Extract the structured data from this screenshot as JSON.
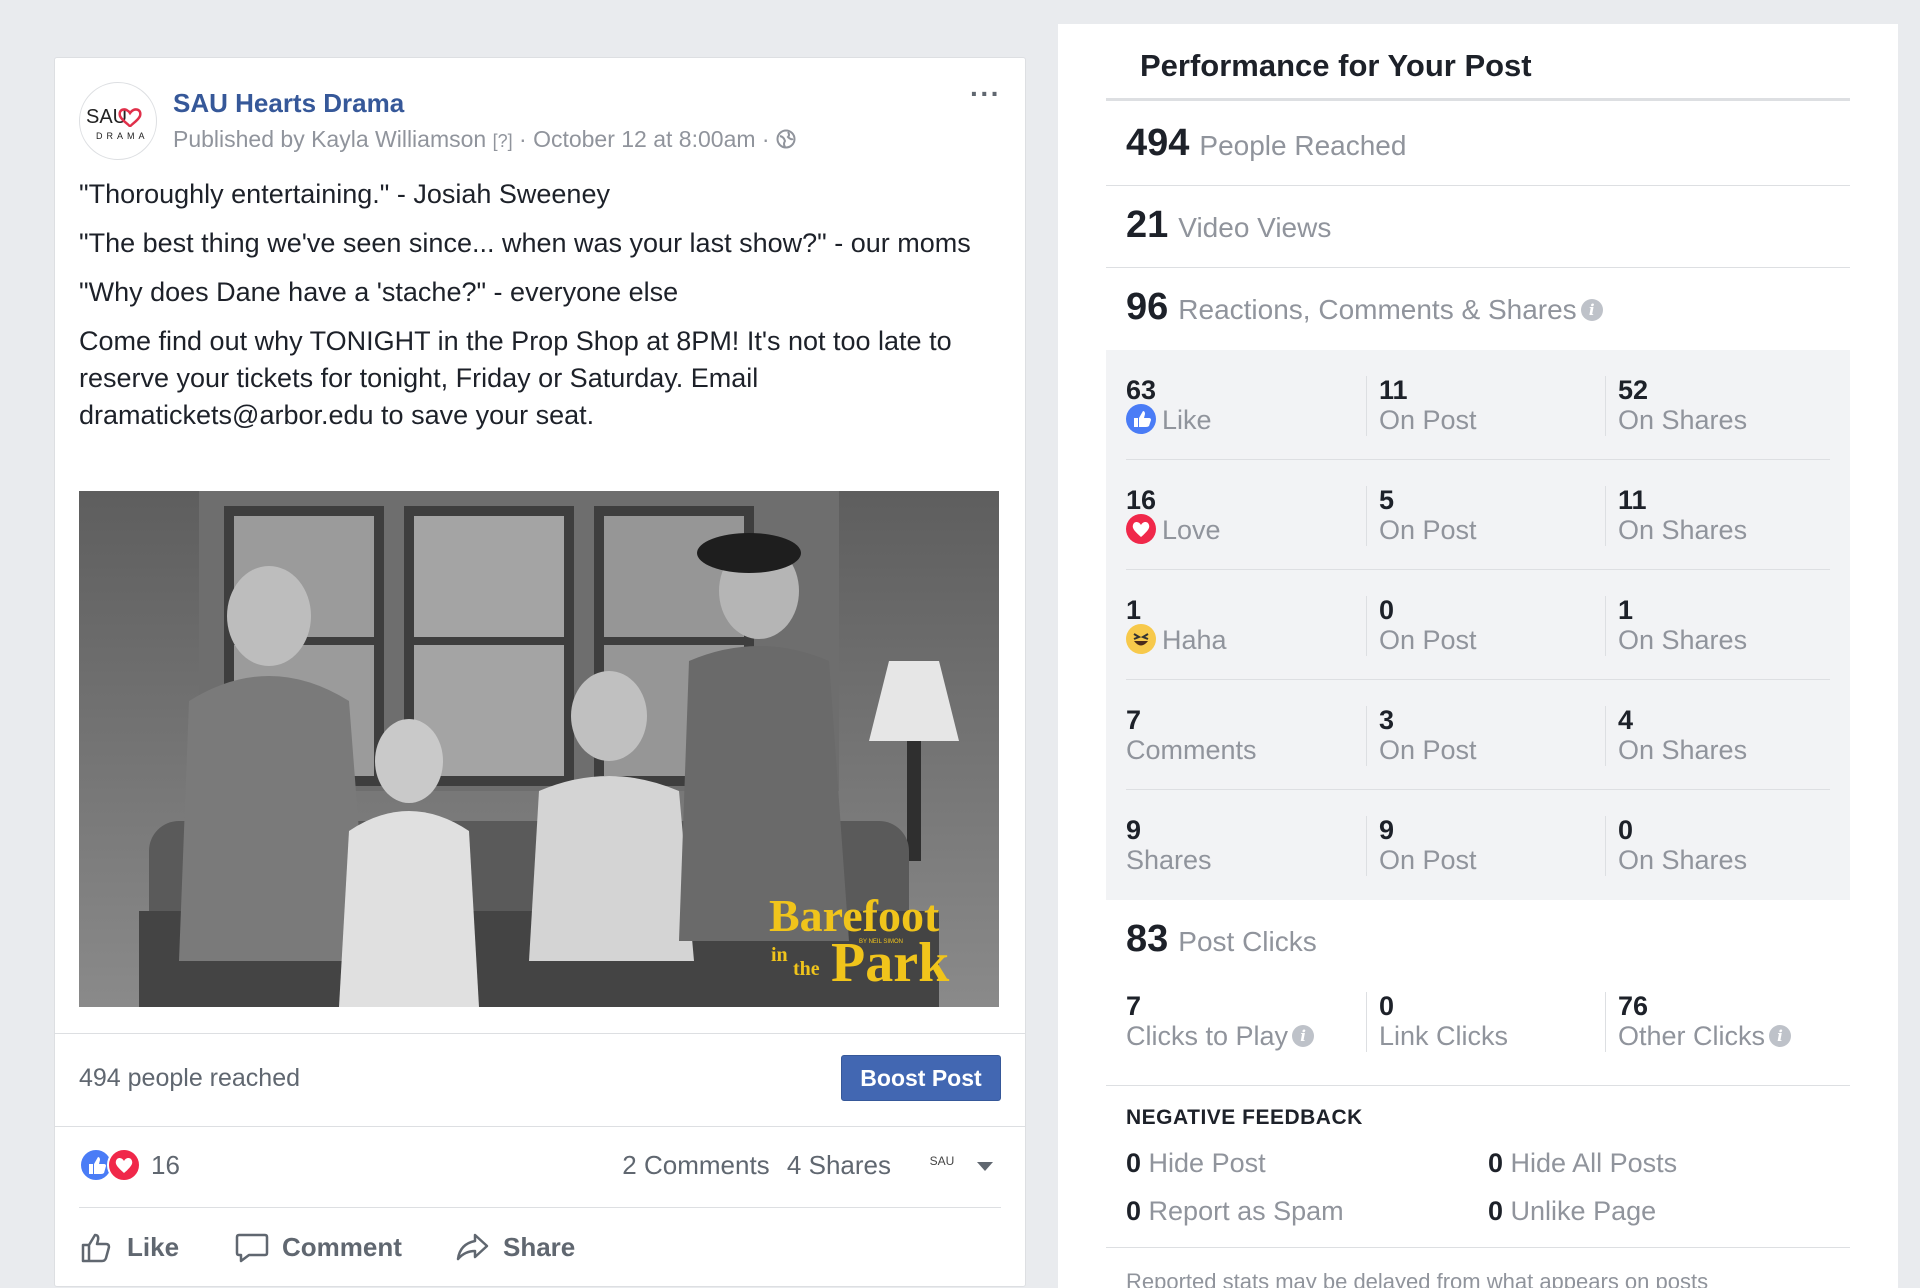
{
  "post": {
    "page_name": "SAU Hearts Drama",
    "avatar_text": "SAU",
    "avatar_subtext": "DRAMA",
    "published_by": "Published by Kayla Williamson",
    "help_marker": "[?]",
    "separator": "·",
    "date": "October 12 at 8:00am",
    "more_label": "···",
    "paragraphs": [
      "\"Thoroughly entertaining.\" - Josiah Sweeney",
      "\"The best thing we've seen since... when was your last show?\" - our moms",
      "\"Why does Dane have a 'stache?\" - everyone else",
      "Come find out why TONIGHT in the Prop Shop at 8PM! It's not too late to reserve your tickets for tonight, Friday or Saturday. Email dramatickets@arbor.edu to save your seat."
    ],
    "video_title_line1": "Barefoot",
    "video_title_in": "in",
    "video_title_the": "the",
    "video_title_line2": "Park",
    "video_byline": "BY NEIL SIMON",
    "people_reached": "494 people reached",
    "boost_label": "Boost Post",
    "reaction_count": "16",
    "comments_label": "2 Comments",
    "shares_label": "4 Shares",
    "actions": {
      "like": "Like",
      "comment": "Comment",
      "share": "Share"
    }
  },
  "performance": {
    "title": "Performance for Your Post",
    "reached_num": "494",
    "reached_label": "People Reached",
    "views_num": "21",
    "views_label": "Video Views",
    "engage_num": "96",
    "engage_label": "Reactions, Comments & Shares",
    "breakdown": [
      {
        "total": "63",
        "label": "Like",
        "on_post": "11",
        "on_post_label": "On Post",
        "on_shares": "52",
        "on_shares_label": "On Shares"
      },
      {
        "total": "16",
        "label": "Love",
        "on_post": "5",
        "on_post_label": "On Post",
        "on_shares": "11",
        "on_shares_label": "On Shares"
      },
      {
        "total": "1",
        "label": "Haha",
        "on_post": "0",
        "on_post_label": "On Post",
        "on_shares": "1",
        "on_shares_label": "On Shares"
      },
      {
        "total": "7",
        "label": "Comments",
        "on_post": "3",
        "on_post_label": "On Post",
        "on_shares": "4",
        "on_shares_label": "On Shares"
      },
      {
        "total": "9",
        "label": "Shares",
        "on_post": "9",
        "on_post_label": "On Post",
        "on_shares": "0",
        "on_shares_label": "On Shares"
      }
    ],
    "clicks_num": "83",
    "clicks_label": "Post Clicks",
    "clicks": [
      {
        "num": "7",
        "label": "Clicks to Play"
      },
      {
        "num": "0",
        "label": "Link Clicks"
      },
      {
        "num": "76",
        "label": "Other Clicks"
      }
    ],
    "negative_title": "NEGATIVE FEEDBACK",
    "negative": [
      {
        "num": "0",
        "label": "Hide Post"
      },
      {
        "num": "0",
        "label": "Hide All Posts"
      },
      {
        "num": "0",
        "label": "Report as Spam"
      },
      {
        "num": "0",
        "label": "Unlike Page"
      }
    ],
    "footnote": "Reported stats may be delayed from what appears on posts"
  },
  "colors": {
    "link_blue": "#365899",
    "button_blue": "#4267b2",
    "like_blue": "#4a7cf6",
    "love_red": "#f0284a",
    "haha_yellow": "#f7c94b",
    "muted_text": "#90949c",
    "page_bg": "#e9ebee"
  },
  "icons": [
    "globe-icon",
    "like-reaction-icon",
    "love-reaction-icon",
    "haha-reaction-icon",
    "info-icon",
    "thumbs-up-icon",
    "comment-icon",
    "share-icon",
    "chevron-down-icon"
  ]
}
